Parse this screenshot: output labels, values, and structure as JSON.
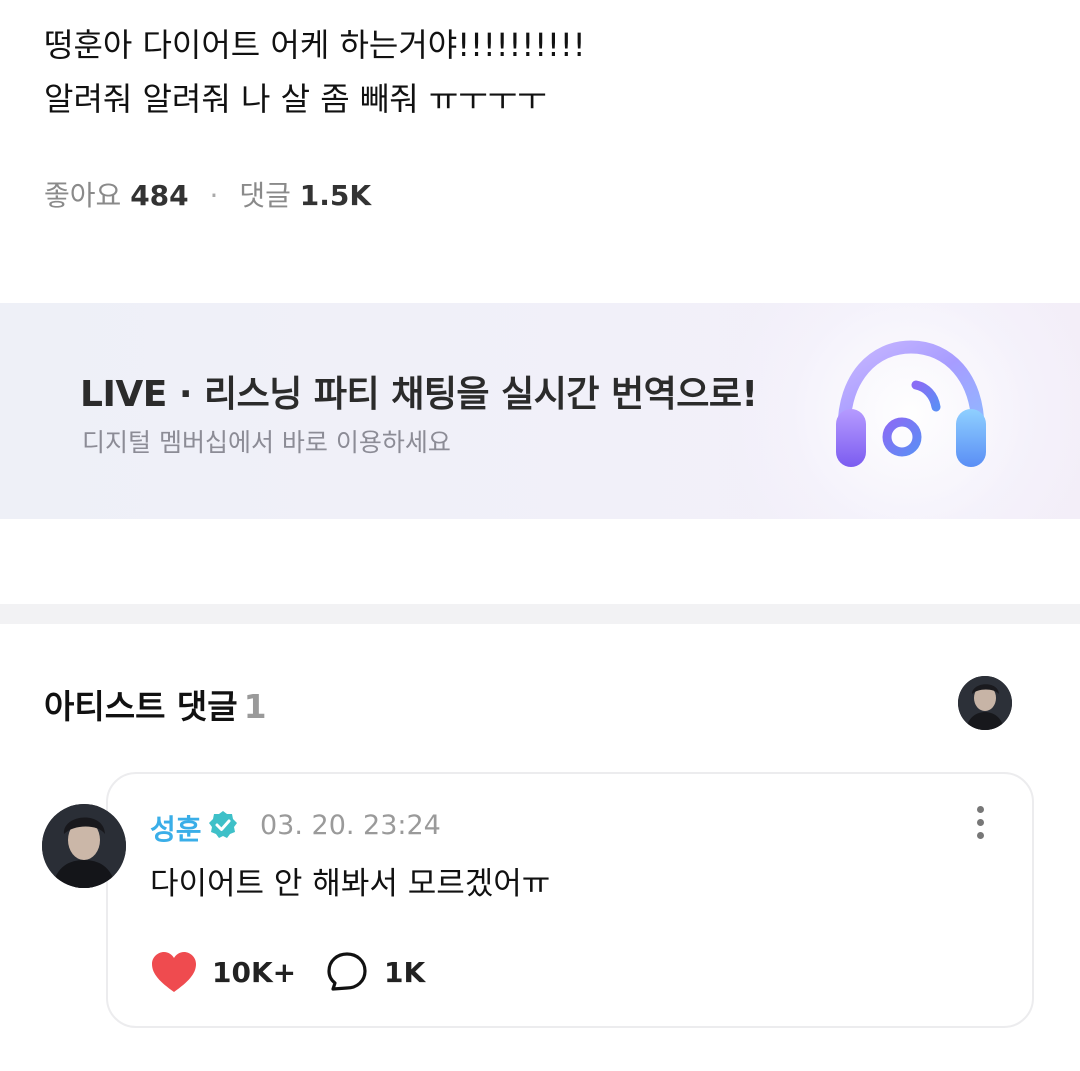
{
  "post": {
    "lines": [
      "떵훈아 다이어트 어케 하는거야!!!!!!!!!!",
      "알려줘 알려줘 나 살 좀 빼줘 ㅠㅜㅜㅜ"
    ],
    "likes_label": "좋아요",
    "likes_count": "484",
    "separator": "·",
    "comments_label": "댓글",
    "comments_count": "1.5K"
  },
  "banner": {
    "title": "LIVE · 리스닝 파티 채팅을 실시간 번역으로!",
    "subtitle": "디지털 멤버십에서 바로 이용하세요",
    "icon": "headphone-music-icon"
  },
  "artist_comments": {
    "title": "아티스트 댓글",
    "count": "1",
    "comment": {
      "author": "성훈",
      "verified_icon": "verified-badge-icon",
      "timestamp": "03. 20. 23:24",
      "text": "다이어트 안 해봐서 모르겠어ㅠ",
      "likes": "10K+",
      "replies": "1K",
      "like_icon": "heart-icon",
      "reply_icon": "speech-bubble-icon",
      "more_icon": "more-vertical-icon"
    }
  },
  "colors": {
    "accent_name": "#3aaee8",
    "like_heart": "#ef4b4f",
    "banner_bg": "#eef0f7"
  }
}
